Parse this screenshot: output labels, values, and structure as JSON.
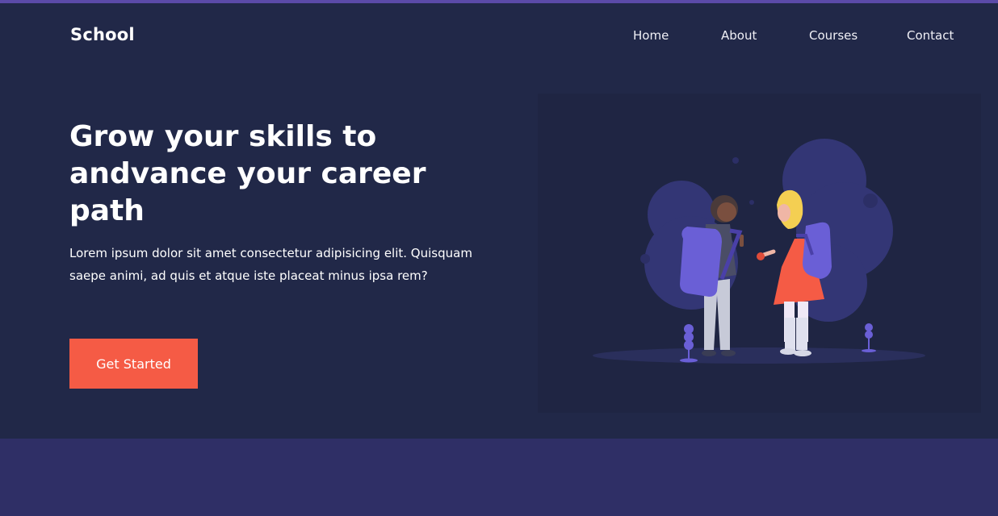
{
  "header": {
    "logo": "School",
    "nav": [
      {
        "label": "Home"
      },
      {
        "label": "About"
      },
      {
        "label": "Courses"
      },
      {
        "label": "Contact"
      }
    ]
  },
  "hero": {
    "headline": "Grow your skills to andvance your career path",
    "description": "Lorem ipsum dolor sit amet consectetur adipisicing elit. Quisquam saepe animi, ad quis et atque iste placeat minus ipsa rem?",
    "cta_label": "Get Started"
  },
  "colors": {
    "hero_bg": "#212848",
    "section_bg": "#2f2f66",
    "accent": "#f55b45",
    "top_border": "#5b4aa8"
  },
  "illustration": {
    "name": "two-students-with-backpacks"
  }
}
